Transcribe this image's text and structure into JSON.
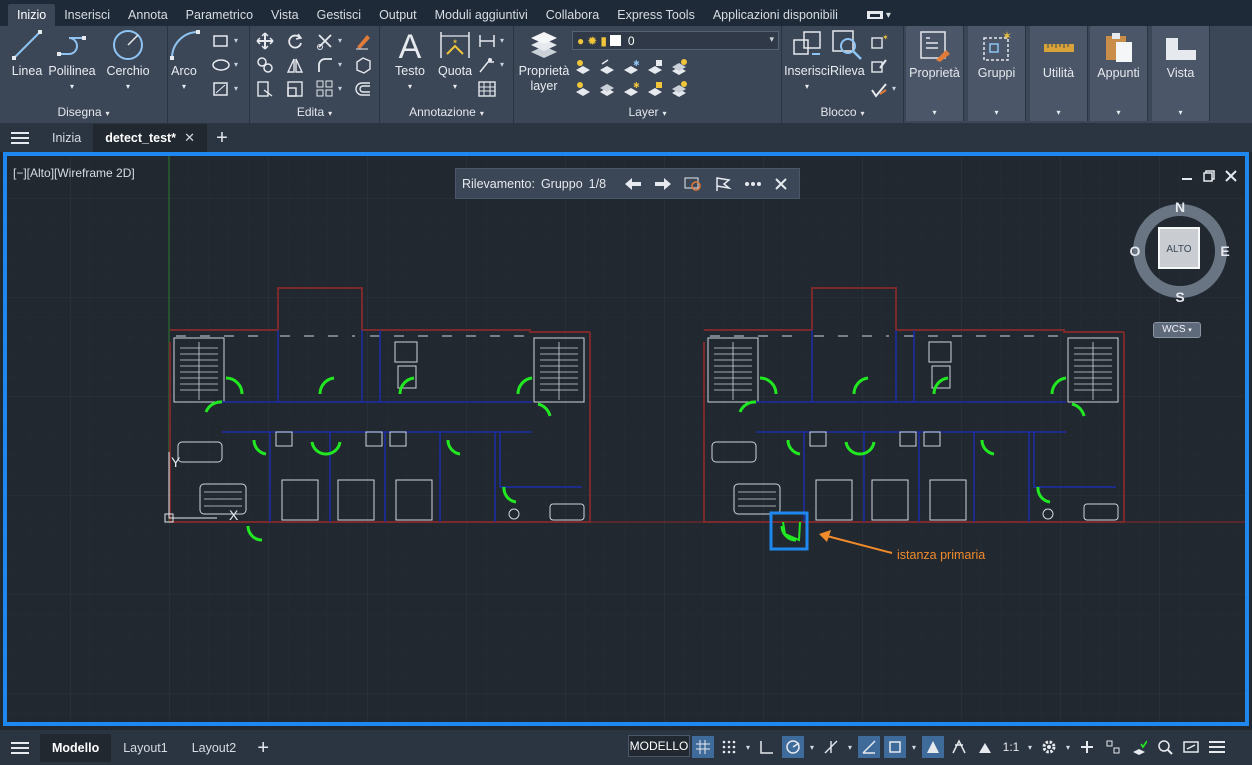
{
  "menubar": {
    "tabs": [
      "Inizio",
      "Inserisci",
      "Annota",
      "Parametrico",
      "Vista",
      "Gestisci",
      "Output",
      "Moduli aggiuntivi",
      "Collabora",
      "Express Tools",
      "Applicazioni disponibili"
    ],
    "active": "Inizio"
  },
  "ribbon": {
    "disegna": {
      "title": "Disegna",
      "linea": "Linea",
      "polilinea": "Polilinea",
      "cerchio": "Cerchio",
      "arco": "Arco"
    },
    "edita": {
      "title": "Edita"
    },
    "annotazione": {
      "title": "Annotazione",
      "testo": "Testo",
      "quota": "Quota"
    },
    "layer": {
      "title": "Layer",
      "proprieta_layer_1": "Proprietà",
      "proprieta_layer_2": "layer",
      "current_layer": "0"
    },
    "blocco": {
      "title": "Blocco",
      "inserisci": "Inserisci",
      "rileva": "Rileva"
    },
    "side": {
      "proprieta": "Proprietà",
      "gruppi": "Gruppi",
      "utilita": "Utilità",
      "appunti": "Appunti",
      "vista": "Vista"
    }
  },
  "doc_tabs": {
    "start": "Inizia",
    "active": "detect_test*"
  },
  "viewport": {
    "label": "[−][Alto][Wireframe 2D]",
    "detection": {
      "label": "Rilevamento:",
      "group": "Gruppo",
      "counter": "1/8"
    },
    "viewcube": {
      "north": "N",
      "south": "S",
      "east": "E",
      "west": "O",
      "face": "ALTO",
      "wcs": "WCS"
    },
    "annotation": "istanza primaria",
    "ucs": {
      "x": "X",
      "y": "Y"
    }
  },
  "status": {
    "tabs": [
      "Modello",
      "Layout1",
      "Layout2"
    ],
    "active": "Modello",
    "model_btn": "MODELLO",
    "scale": "1:1"
  },
  "colors": {
    "accent": "#1e88f0",
    "door": "#22e822",
    "annotation": "#f08a2a",
    "wall": "#7a2a2a",
    "inner": "#1c2ea6"
  }
}
